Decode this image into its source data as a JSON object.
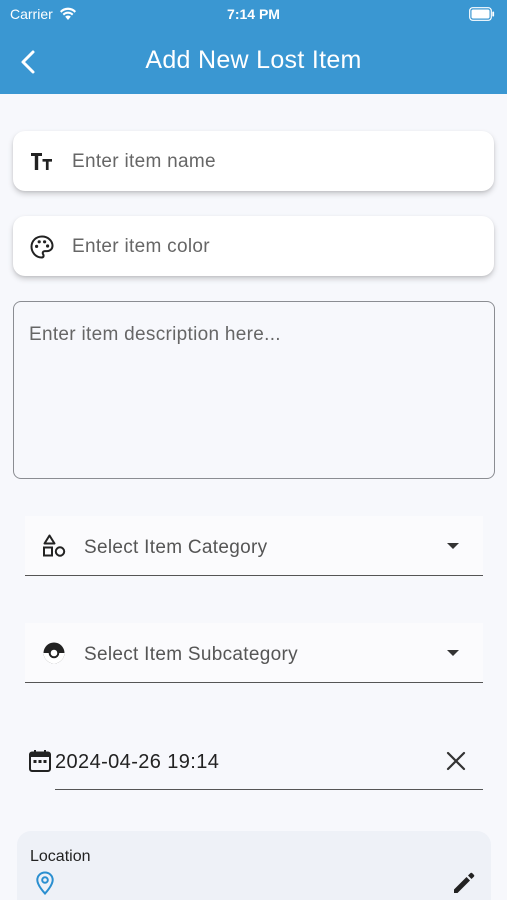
{
  "status_bar": {
    "carrier": "Carrier",
    "time": "7:14 PM"
  },
  "app_bar": {
    "title": "Add New Lost Item",
    "back_icon": "chevron-left-icon",
    "background": "#3a97d2"
  },
  "form": {
    "item_name": {
      "placeholder": "Enter item name",
      "icon": "text-fields-icon"
    },
    "item_color": {
      "placeholder": "Enter item color",
      "icon": "palette-icon"
    },
    "description": {
      "placeholder": "Enter item description here..."
    },
    "category": {
      "placeholder": "Select Item Category",
      "icon": "category-shapes-icon"
    },
    "subcategory": {
      "placeholder": "Select Item Subcategory",
      "icon": "pokeball-icon"
    },
    "date": {
      "value": "2024-04-26 19:14",
      "icon": "calendar-icon",
      "clear_icon": "close-icon"
    },
    "location": {
      "label": "Location",
      "icon": "location-pin-icon",
      "edit_icon": "pencil-icon"
    }
  },
  "colors": {
    "accent": "#3a97d2",
    "pin": "#2a8fd0"
  }
}
